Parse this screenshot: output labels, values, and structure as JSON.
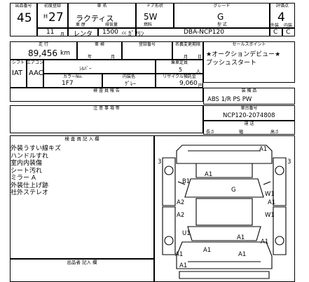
{
  "header": {
    "lot_label": "出品番号",
    "lot": "45",
    "year_label": "初度登録",
    "era": "H",
    "year": "27",
    "car_name_label": "車 名",
    "car_name": "ラクティス",
    "doors_label": "ドア形状",
    "doors": "5W",
    "grade_label": "グレード",
    "grade": "G",
    "score_label": "評価点",
    "score": "4",
    "month": "11",
    "month_unit": "月",
    "category_label": "車 歴",
    "category": "レンタ",
    "cc_label": "排気量",
    "cc": "1500",
    "cc_unit": "cc",
    "fuel_label": "燃料",
    "fuel": "ｶﾞｿﾘﾝ",
    "model_label": "型 式",
    "model": "DBA-NCP120",
    "interior_label": "外装",
    "interior_score": "C",
    "exterior_label": "内装",
    "exterior_score": "C"
  },
  "row2": {
    "mileage_label": "走 行",
    "mileage": "89,456",
    "mileage_unit": "km",
    "inspection_label": "車 検",
    "year_unit": "年",
    "month_unit": "月",
    "regno_label": "登録番号",
    "expiry_label": "名義変更期限",
    "day_unit": "日",
    "sales_label": "セールスポイント",
    "sales_line1": "★オークションデビュー★",
    "sales_line2": "プッシュスタート"
  },
  "row3": {
    "shift_label": "シフト",
    "shift": "IAT",
    "ac_label": "エアコン",
    "ac": "AAC",
    "seats_label": "乗車定員",
    "seats": "5",
    "seats_unit": "人",
    "color_label": "カラーNo.",
    "color": "1F7",
    "color_name": "ｼﾙﾊﾞｰ",
    "trim_label": "内装色",
    "trim": "ｸﾞﾚｰ",
    "recycle_label": "リサイクル預託金",
    "recycle": "9,060",
    "recycle_unit": "円",
    "inspector_label": "検 査 員 報 告"
  },
  "equipment": {
    "label": "装 備 品",
    "value": "ABS 1/R PS PW",
    "chassis_label": "車台番号",
    "chassis": "NCP120-2074808",
    "notes_label": "注 意 事 項 等",
    "transport_label": "運 送",
    "length_label": "長さ",
    "width_label": "幅",
    "height_label": "高さ"
  },
  "notes": {
    "title": "検 査 員 記 入 欄",
    "lines": [
      "外装うすい線キズ",
      "ハンドルすれ",
      "室内内装傷",
      "シート汚れ",
      "ミラー A",
      "外装仕上げ跡",
      "社外ステレオ"
    ],
    "footer": "出品者 記入 欄"
  },
  "damage_marks": [
    "A1",
    "3",
    "3",
    "A1",
    "B1",
    "G",
    "W1",
    "A2",
    "A1",
    "A2",
    "U1",
    "A1",
    "W1",
    "A1",
    "A1",
    "A1",
    "A1",
    "A1"
  ]
}
